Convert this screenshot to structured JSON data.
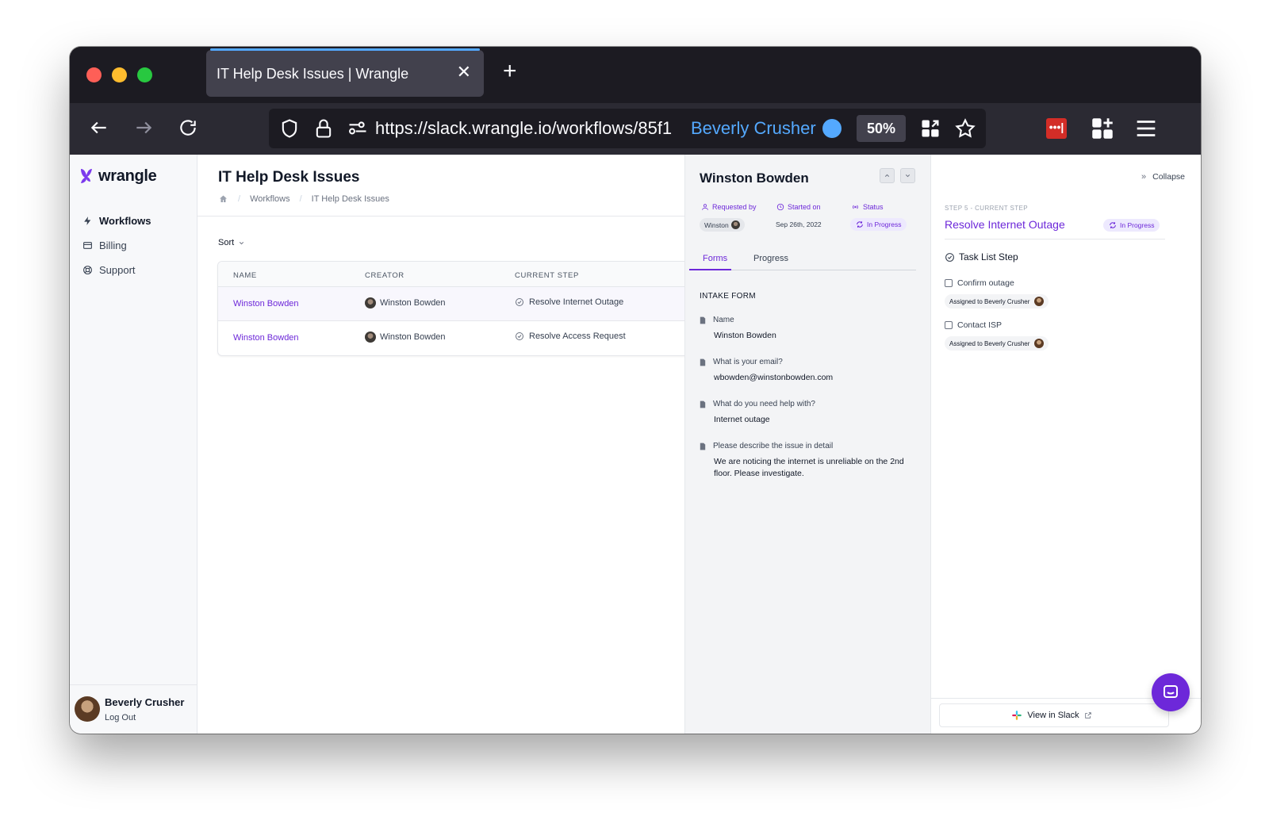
{
  "browser": {
    "tab_title": "IT Help Desk Issues | Wrangle",
    "tab_close": "✕",
    "new_tab": "+",
    "url": "https://slack.wrangle.io/workflows/85f1",
    "container_name": "Beverly Crusher",
    "zoom": "50%"
  },
  "sidebar": {
    "logo": "wrangle",
    "items": [
      {
        "label": "Workflows",
        "icon": "bolt-icon"
      },
      {
        "label": "Billing",
        "icon": "credit-card-icon"
      },
      {
        "label": "Support",
        "icon": "lifebuoy-icon"
      }
    ],
    "user": {
      "name": "Beverly Crusher",
      "logout": "Log Out"
    }
  },
  "main": {
    "title": "IT Help Desk Issues",
    "breadcrumb": [
      "Workflows",
      "IT Help Desk Issues"
    ],
    "sort_label": "Sort",
    "table": {
      "headers": [
        "Name",
        "Creator",
        "Current Step"
      ],
      "rows": [
        {
          "name": "Winston Bowden",
          "creator": "Winston Bowden",
          "step": "Resolve Internet Outage"
        },
        {
          "name": "Winston Bowden",
          "creator": "Winston Bowden",
          "step": "Resolve Access Request"
        }
      ]
    }
  },
  "detail": {
    "title": "Winston Bowden",
    "meta": {
      "requested_by_label": "Requested by",
      "requested_by_value": "Winston",
      "started_on_label": "Started on",
      "started_on_value": "Sep 26th, 2022",
      "status_label": "Status",
      "status_value": "In Progress"
    },
    "tabs": [
      "Forms",
      "Progress"
    ],
    "section": "INTAKE FORM",
    "fields": [
      {
        "q": "Name",
        "a": "Winston Bowden"
      },
      {
        "q": "What is your email?",
        "a": "wbowden@winstonbowden.com"
      },
      {
        "q": "What do you need help with?",
        "a": "Internet outage"
      },
      {
        "q": "Please describe the issue in detail",
        "a": "We are noticing the internet is unreliable on the 2nd floor. Please investigate."
      }
    ]
  },
  "step_panel": {
    "collapse": "Collapse",
    "kicker": "Step 5 - Current Step",
    "title": "Resolve Internet Outage",
    "status": "In Progress",
    "task_list_title": "Task List Step",
    "tasks": [
      {
        "label": "Confirm outage",
        "assignee": "Assigned to Beverly Crusher"
      },
      {
        "label": "Contact ISP",
        "assignee": "Assigned to Beverly Crusher"
      }
    ],
    "view_in_slack": "View in Slack"
  },
  "colors": {
    "accent": "#6d28d9",
    "browser_accent": "#54a9ff"
  }
}
